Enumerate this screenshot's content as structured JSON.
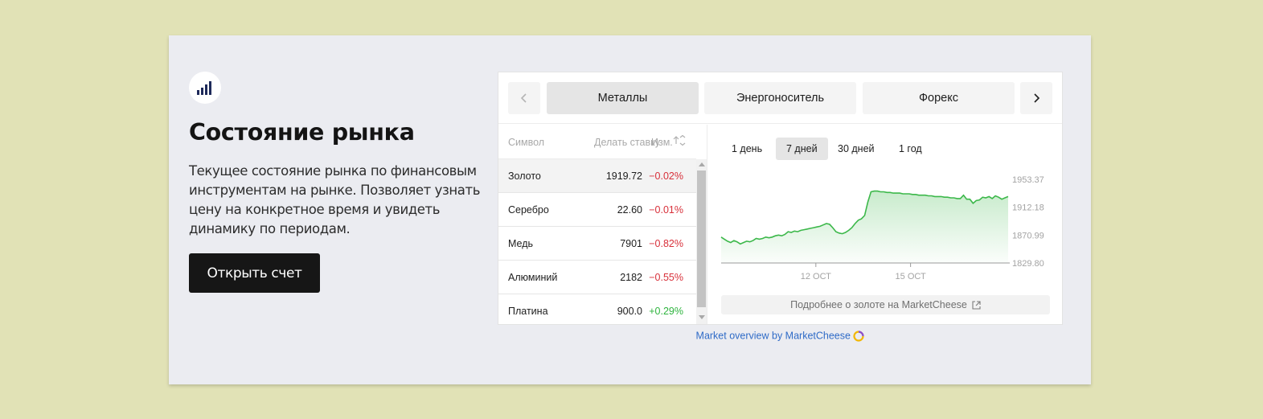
{
  "hero": {
    "title": "Состояние рынка",
    "description": "Текущее состояние рынка по финансовым инструментам на рынке. Позволяет узнать цену на конкретное время и увидеть динамику по периодам.",
    "cta_label": "Открыть счет",
    "logo_icon": "signal-bars-icon"
  },
  "widget": {
    "tabs": [
      {
        "label": "Металлы",
        "active": true
      },
      {
        "label": "Энергоноситель",
        "active": false
      },
      {
        "label": "Форекс",
        "active": false
      }
    ],
    "table": {
      "headers": {
        "symbol": "Символ",
        "price": "Делать ставку",
        "change": "Изм."
      },
      "rows": [
        {
          "symbol": "Золото",
          "price": "1919.72",
          "change": "−0.02%",
          "direction": "down"
        },
        {
          "symbol": "Серебро",
          "price": "22.60",
          "change": "−0.01%",
          "direction": "down"
        },
        {
          "symbol": "Медь",
          "price": "7901",
          "change": "−0.82%",
          "direction": "down"
        },
        {
          "symbol": "Алюминий",
          "price": "2182",
          "change": "−0.55%",
          "direction": "down"
        },
        {
          "symbol": "Платина",
          "price": "900.0",
          "change": "+0.29%",
          "direction": "up"
        }
      ]
    },
    "periods": [
      {
        "label": "1 день",
        "active": false
      },
      {
        "label": "7 дней",
        "active": true
      },
      {
        "label": "30 дней",
        "active": false
      },
      {
        "label": "1 год",
        "active": false
      }
    ],
    "more_link": "Подробнее о золоте на MarketCheese",
    "credit": "Market overview by MarketCheese"
  },
  "colors": {
    "positive": "#2fb43f",
    "negative": "#d8303a",
    "line": "#3cb84a",
    "link": "#2f6bc7"
  },
  "chart_data": {
    "type": "area",
    "y_ticks": [
      "1953.37",
      "1912.18",
      "1870.99",
      "1829.80"
    ],
    "x_ticks": [
      {
        "label": "12 ОСТ",
        "t": 0.33
      },
      {
        "label": "15 ОСТ",
        "t": 0.66
      }
    ],
    "ylim": [
      1829.8,
      1953.37
    ],
    "values": [
      1868,
      1865,
      1862,
      1860,
      1863,
      1861,
      1858,
      1860,
      1862,
      1861,
      1863,
      1866,
      1865,
      1866,
      1868,
      1867,
      1868,
      1870,
      1871,
      1870,
      1872,
      1876,
      1875,
      1877,
      1876,
      1878,
      1879,
      1880,
      1881,
      1882,
      1883,
      1884,
      1886,
      1888,
      1887,
      1882,
      1876,
      1874,
      1873,
      1875,
      1878,
      1882,
      1888,
      1893,
      1895,
      1900,
      1920,
      1935,
      1936,
      1936,
      1935,
      1935,
      1934,
      1934,
      1933,
      1933,
      1933,
      1932,
      1932,
      1932,
      1931,
      1931,
      1930,
      1930,
      1930,
      1929,
      1929,
      1928,
      1928,
      1928,
      1927,
      1927,
      1926,
      1926,
      1925,
      1925,
      1930,
      1924,
      1924,
      1918,
      1922,
      1923,
      1927,
      1926,
      1928,
      1925,
      1929,
      1927,
      1924,
      1926,
      1928
    ]
  }
}
